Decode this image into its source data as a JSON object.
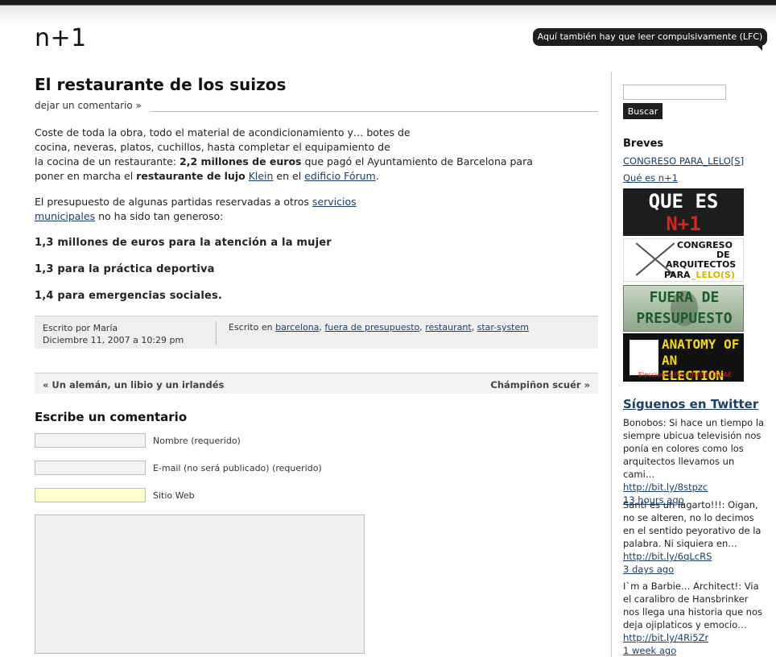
{
  "site": {
    "logo": "n+1",
    "tagline": "Aquí también hay que leer compulsivamente (LFC)"
  },
  "post": {
    "title": "El restaurante de los suizos",
    "comment_link": "dejar un comentario »",
    "p1_a": "Coste de toda la obra, todo el material de acondicionamiento y… botes de",
    "p1_b": "cocina, neveras, platos, cuchillos, hasta completar el equipamiento de",
    "p1_c": "la cocina de un restaurante: ",
    "p1_c_bold": "2,2 millones de euros",
    "p1_c_rest": " que pagó el Ayuntamiento de Barcelona para",
    "p1_d": "poner en marcha el ",
    "p1_d_bold": "restaurante de lujo",
    "p1_d_space": " ",
    "p1_d_link1": "Klein",
    "p1_d_mid": " en el ",
    "p1_d_link2": "edificio Fórum",
    "p1_d_end": ".",
    "p2_a": "El presupuesto de algunas partidas reservadas a otros ",
    "p2_link": "servicios municipales",
    "p2_end": " no ha sido tan generoso:",
    "line1": "1,3 millones de euros para la atención a la mujer",
    "line2": "1,3 para la práctica deportiva",
    "line3": "1,4 para emergencias sociales.",
    "author": "Escrito por María",
    "date": "Diciembre 11, 2007 a 10:29 pm",
    "cats_label": "Escrito en ",
    "cats": [
      "barcelona",
      "fuera de presupuesto",
      "restaurant",
      "star-system"
    ]
  },
  "nav": {
    "prev": "« Un alemán, un libio y un irlandés",
    "next": "Chámpiñon scuér »"
  },
  "form": {
    "title": "Escribe un comentario",
    "name_label": "Nombre (requerido)",
    "email_label": "E-mail (no será publicado) (requerido)",
    "web_label": "Sitio Web"
  },
  "sidebar": {
    "search_button": "Buscar",
    "breves_title": "Breves",
    "link1": "CONGRESO PARA_LELO[S]",
    "link2": "Qué es n+1",
    "banner1_line1": "QUE ES",
    "banner1_line2": "N+1",
    "banner2_line1": "CONGRESO",
    "banner2_line2": "DE",
    "banner2_line3": "ARQUITECTOS",
    "banner2_line4a": "PARA",
    "banner2_line4b": "_LELO(S)",
    "banner3_line1": "FUERA DE",
    "banner3_line2": "PRESUPUESTO",
    "banner4_line1": "ANATOMY OF",
    "banner4_line2": "AN ELECTION",
    "banner4_sub": "Elecciones Presidente CSCAE",
    "twitter_title": "Síguenos en Twitter",
    "tweets": [
      {
        "text": "Bonobos: Si hace un tiempo la siempre ubicua televisión nos ponía en colores como los arquitectos llevamos un cami…",
        "link": "http://bit.ly/8stpzc",
        "time": "13 hours ago"
      },
      {
        "text": "Santi es un lagarto!!!: Oigan, no se alteren, no lo decimos en el sentido peyorativo de la palabra. Ni siquiera en…",
        "link": "http://bit.ly/6qLcRS",
        "time": "3 days ago"
      },
      {
        "text": "I`m a Barbie… Architect!: Via el caralibro de Hansbrinker nos llega una historia que nos deja ojiplaticos y emocio…",
        "link": "http://bit.ly/4Ri5Zr",
        "time": "1 week ago"
      }
    ]
  }
}
